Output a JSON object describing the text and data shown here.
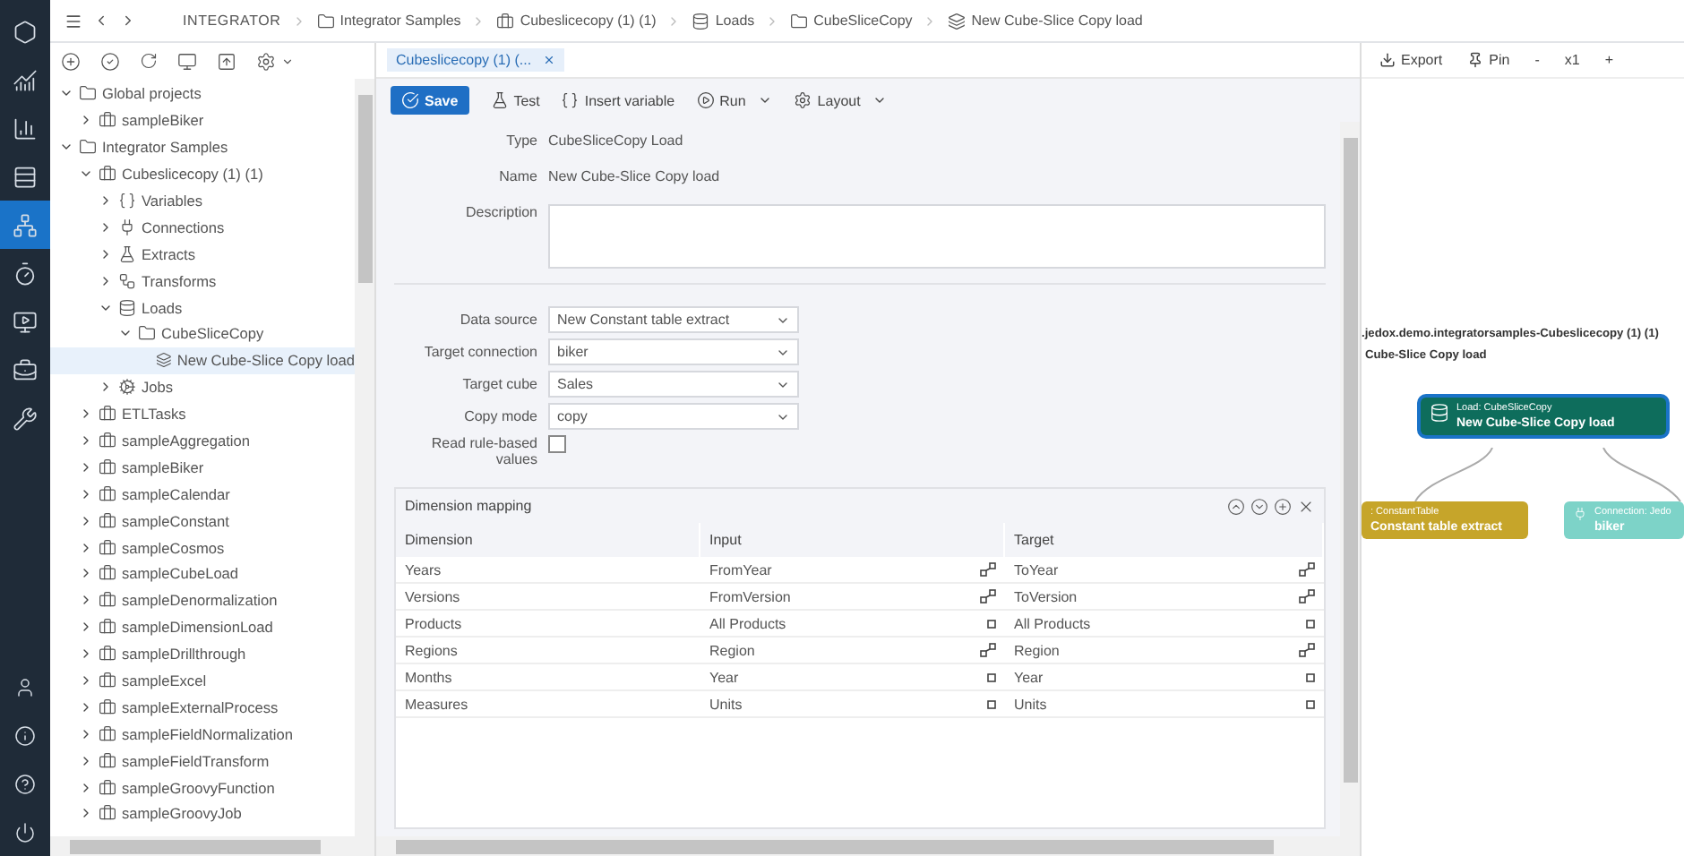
{
  "rail": {
    "items": [
      {
        "selected": false
      },
      {
        "selected": false
      },
      {
        "selected": false
      },
      {
        "selected": false
      },
      {
        "selected": true
      },
      {
        "selected": false
      },
      {
        "selected": false
      },
      {
        "selected": false
      },
      {
        "selected": false
      }
    ],
    "bottom_items": [
      {
        "selected": false
      },
      {
        "selected": false
      },
      {
        "selected": false
      },
      {
        "selected": false
      }
    ]
  },
  "breadcrumbs": [
    {
      "kind": "root",
      "label": "INTEGRATOR"
    },
    {
      "kind": "folder",
      "label": "Integrator Samples"
    },
    {
      "kind": "project",
      "label": "Cubeslicecopy (1) (1)"
    },
    {
      "kind": "loads",
      "label": "Loads"
    },
    {
      "kind": "folder",
      "label": "CubeSliceCopy"
    },
    {
      "kind": "load",
      "label": "New Cube-Slice Copy load"
    }
  ],
  "tree": {
    "items": [
      {
        "kind": "folder",
        "label": "Global projects",
        "expanded": true,
        "selected": false,
        "children": [
          {
            "kind": "project",
            "label": "sampleBiker",
            "expanded": false,
            "selected": false
          }
        ]
      },
      {
        "kind": "folder",
        "label": "Integrator Samples",
        "expanded": true,
        "selected": false,
        "children": [
          {
            "kind": "project",
            "label": "Cubeslicecopy (1) (1)",
            "expanded": true,
            "selected": false,
            "children": [
              {
                "kind": "variables",
                "label": "Variables",
                "expanded": false,
                "selected": false
              },
              {
                "kind": "connections",
                "label": "Connections",
                "expanded": false,
                "selected": false
              },
              {
                "kind": "extracts",
                "label": "Extracts",
                "expanded": false,
                "selected": false
              },
              {
                "kind": "transforms",
                "label": "Transforms",
                "expanded": false,
                "selected": false
              },
              {
                "kind": "loads",
                "label": "Loads",
                "expanded": true,
                "selected": false,
                "children": [
                  {
                    "kind": "folder",
                    "label": "CubeSliceCopy",
                    "expanded": true,
                    "selected": false,
                    "children": [
                      {
                        "kind": "load",
                        "label": "New Cube-Slice Copy load",
                        "selected": true
                      }
                    ]
                  }
                ]
              },
              {
                "kind": "jobs",
                "label": "Jobs",
                "expanded": false,
                "selected": false
              }
            ]
          },
          {
            "kind": "project",
            "label": "ETLTasks",
            "expanded": false,
            "selected": false
          },
          {
            "kind": "project",
            "label": "sampleAggregation",
            "expanded": false,
            "selected": false
          },
          {
            "kind": "project",
            "label": "sampleBiker",
            "expanded": false,
            "selected": false
          },
          {
            "kind": "project",
            "label": "sampleCalendar",
            "expanded": false,
            "selected": false
          },
          {
            "kind": "project",
            "label": "sampleConstant",
            "expanded": false,
            "selected": false
          },
          {
            "kind": "project",
            "label": "sampleCosmos",
            "expanded": false,
            "selected": false
          },
          {
            "kind": "project",
            "label": "sampleCubeLoad",
            "expanded": false,
            "selected": false
          },
          {
            "kind": "project",
            "label": "sampleDenormalization",
            "expanded": false,
            "selected": false
          },
          {
            "kind": "project",
            "label": "sampleDimensionLoad",
            "expanded": false,
            "selected": false
          },
          {
            "kind": "project",
            "label": "sampleDrillthrough",
            "expanded": false,
            "selected": false
          },
          {
            "kind": "project",
            "label": "sampleExcel",
            "expanded": false,
            "selected": false
          },
          {
            "kind": "project",
            "label": "sampleExternalProcess",
            "expanded": false,
            "selected": false
          },
          {
            "kind": "project",
            "label": "sampleFieldNormalization",
            "expanded": false,
            "selected": false
          },
          {
            "kind": "project",
            "label": "sampleFieldTransform",
            "expanded": false,
            "selected": false
          },
          {
            "kind": "project",
            "label": "sampleGroovyFunction",
            "expanded": false,
            "selected": false
          },
          {
            "kind": "project",
            "label": "sampleGroovyJob",
            "expanded": false,
            "selected": false
          }
        ]
      }
    ]
  },
  "tabs": [
    {
      "label": "Cubeslicecopy (1) (...",
      "selected": true
    }
  ],
  "toolbar": [
    {
      "kind": "primary",
      "label": "Save",
      "dropdown": false
    },
    {
      "kind": "plain",
      "label": "Test",
      "dropdown": false
    },
    {
      "kind": "plain",
      "label": "Insert variable",
      "dropdown": false
    },
    {
      "kind": "plain",
      "label": "Run",
      "dropdown": true
    },
    {
      "kind": "plain",
      "label": "Layout",
      "dropdown": true
    }
  ],
  "general": [
    {
      "kind": "text",
      "label": "Type",
      "value": "CubeSliceCopy Load"
    },
    {
      "kind": "text",
      "label": "Name",
      "value": "New Cube-Slice Copy load"
    },
    {
      "kind": "textarea",
      "label": "Description"
    }
  ],
  "settings": [
    {
      "kind": "select",
      "label": "Data source",
      "value": "New Constant table extract"
    },
    {
      "kind": "select",
      "label": "Target connection",
      "value": "biker"
    },
    {
      "kind": "select",
      "label": "Target cube",
      "value": "Sales"
    },
    {
      "kind": "select",
      "label": "Copy mode",
      "value": "copy"
    },
    {
      "kind": "checkbox",
      "label": "Read rule-based values",
      "checked": false
    }
  ],
  "mapping": {
    "title": "Dimension mapping",
    "columns": [
      "Dimension",
      "Input",
      "Target"
    ],
    "rows": [
      {
        "dimension": "Years",
        "input": {
          "value": "FromYear",
          "kind": "mapped"
        },
        "target": {
          "value": "ToYear",
          "kind": "mapped"
        }
      },
      {
        "dimension": "Versions",
        "input": {
          "value": "FromVersion",
          "kind": "mapped"
        },
        "target": {
          "value": "ToVersion",
          "kind": "mapped"
        }
      },
      {
        "dimension": "Products",
        "input": {
          "value": "All Products",
          "kind": "element"
        },
        "target": {
          "value": "All Products",
          "kind": "element"
        }
      },
      {
        "dimension": "Regions",
        "input": {
          "value": "Region",
          "kind": "mapped"
        },
        "target": {
          "value": "Region",
          "kind": "mapped"
        }
      },
      {
        "dimension": "Months",
        "input": {
          "value": "Year",
          "kind": "element"
        },
        "target": {
          "value": "Year",
          "kind": "element"
        }
      },
      {
        "dimension": "Measures",
        "input": {
          "value": "Units",
          "kind": "element"
        },
        "target": {
          "value": "Units",
          "kind": "element"
        }
      }
    ]
  },
  "graph": {
    "toolbar": [
      {
        "kind": "export",
        "label": "Export"
      },
      {
        "kind": "pin",
        "label": "Pin"
      },
      {
        "kind": "text",
        "label": "-"
      },
      {
        "kind": "text",
        "label": "x1"
      },
      {
        "kind": "text",
        "label": "+"
      }
    ],
    "title": ".jedox.demo.integratorsamples-Cubeslicecopy (1) (1)",
    "subtitle": "Cube-Slice Copy load",
    "nodes": [
      {
        "kind": "load",
        "type": "Load: CubeSliceCopy",
        "name": "New Cube-Slice Copy load",
        "selected": true
      },
      {
        "kind": "extract",
        "type": ": ConstantTable",
        "name": "Constant table extract",
        "selected": false
      },
      {
        "kind": "connection",
        "type": "Connection: Jedo",
        "name": "biker",
        "selected": false
      }
    ]
  }
}
